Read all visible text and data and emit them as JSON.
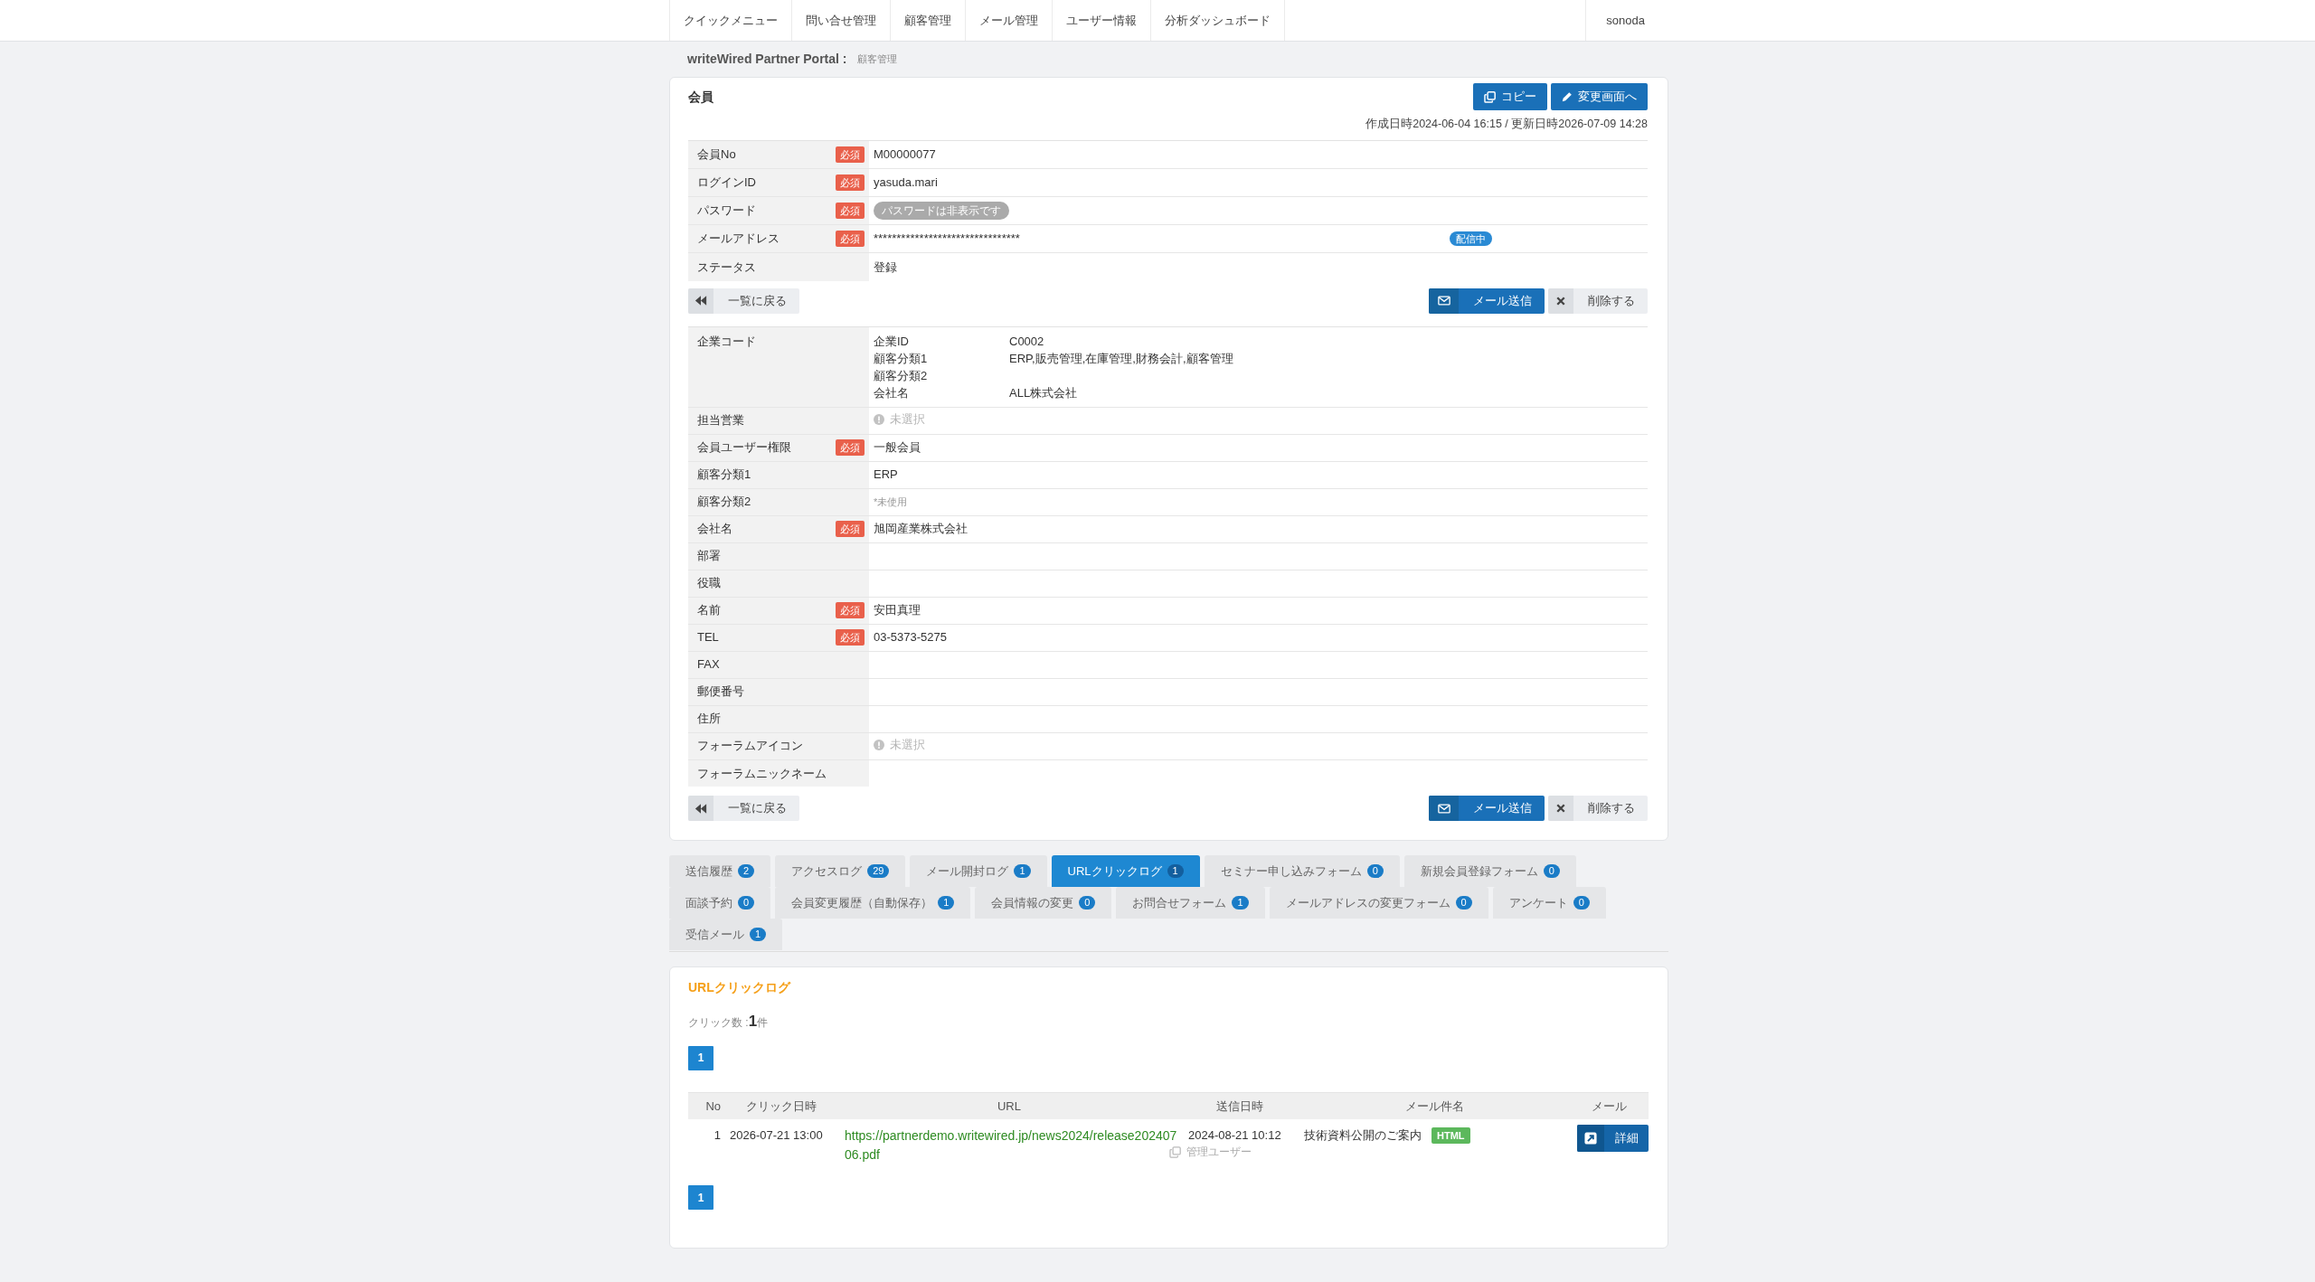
{
  "nav": {
    "items": [
      "クイックメニュー",
      "問い合せ管理",
      "顧客管理",
      "メール管理",
      "ユーザー情報",
      "分析ダッシュボード"
    ],
    "user": "sonoda"
  },
  "breadcrumb": {
    "portal": "writeWired Partner Portal :",
    "current": "顧客管理"
  },
  "member": {
    "title": "会員",
    "actions": [
      {
        "kind": "copy",
        "label": "コピー"
      },
      {
        "kind": "edit",
        "label": "変更画面へ"
      }
    ],
    "timestamps": "作成日時2024-06-04 16:15 / 更新日時2026-07-09 14:28",
    "account_fields": [
      {
        "label": "会員No",
        "badge": "必須",
        "kind": "text",
        "value": "M00000077"
      },
      {
        "label": "ログインID",
        "badge": "必須",
        "kind": "text",
        "value": "yasuda.mari"
      },
      {
        "label": "パスワード",
        "badge": "必須",
        "kind": "hidden",
        "value": "パスワードは非表示です"
      },
      {
        "label": "メールアドレス",
        "badge": "必須",
        "kind": "email",
        "value": "********************************",
        "delivery": "配信中"
      },
      {
        "label": "ステータス",
        "kind": "text",
        "value": "登録"
      }
    ],
    "account_buttons": [
      {
        "kind": "back",
        "label": "一覧に戻る"
      },
      {
        "kind": "mail",
        "label": "メール送信"
      },
      {
        "kind": "delete",
        "label": "削除する"
      }
    ],
    "profile_fields": [
      {
        "label": "企業コード",
        "kind": "company",
        "details": [
          {
            "label": "企業ID",
            "value": "C0002"
          },
          {
            "label": "顧客分類1",
            "value": "ERP,販売管理,在庫管理,財務会計,顧客管理"
          },
          {
            "label": "顧客分類2"
          },
          {
            "label": "会社名",
            "value": "ALL株式会社"
          }
        ]
      },
      {
        "label": "担当営業",
        "kind": "unselected",
        "value": "未選択"
      },
      {
        "label": "会員ユーザー権限",
        "badge": "必須",
        "kind": "text",
        "value": "一般会員"
      },
      {
        "label": "顧客分類1",
        "kind": "text",
        "value": "ERP"
      },
      {
        "label": "顧客分類2",
        "kind": "note",
        "value": "*未使用"
      },
      {
        "label": "会社名",
        "badge": "必須",
        "kind": "text",
        "value": "旭岡産業株式会社"
      },
      {
        "label": "部署",
        "kind": "text"
      },
      {
        "label": "役職",
        "kind": "text"
      },
      {
        "label": "名前",
        "badge": "必須",
        "kind": "text",
        "value": "安田真理"
      },
      {
        "label": "TEL",
        "badge": "必須",
        "kind": "text",
        "value": "03-5373-5275"
      },
      {
        "label": "FAX",
        "kind": "text"
      },
      {
        "label": "郵便番号",
        "kind": "text"
      },
      {
        "label": "住所",
        "kind": "text"
      },
      {
        "label": "フォーラムアイコン",
        "kind": "unselected",
        "value": "未選択"
      },
      {
        "label": "フォーラムニックネーム",
        "kind": "text"
      }
    ],
    "profile_buttons": [
      {
        "kind": "back",
        "label": "一覧に戻る"
      },
      {
        "kind": "mail",
        "label": "メール送信"
      },
      {
        "kind": "delete",
        "label": "削除する"
      }
    ]
  },
  "tabs": [
    {
      "label": "送信履歴",
      "count": "2",
      "selected": false
    },
    {
      "label": "アクセスログ",
      "count": "29",
      "selected": false
    },
    {
      "label": "メール開封ログ",
      "count": "1",
      "selected": false
    },
    {
      "label": "URLクリックログ",
      "count": "1",
      "selected": true
    },
    {
      "label": "セミナー申し込みフォーム",
      "count": "0",
      "selected": false
    },
    {
      "label": "新規会員登録フォーム",
      "count": "0",
      "selected": false
    },
    {
      "label": "面談予約",
      "count": "0",
      "selected": false
    },
    {
      "label": "会員変更履歴（自動保存）",
      "count": "1",
      "selected": false
    },
    {
      "label": "会員情報の変更",
      "count": "0",
      "selected": false
    },
    {
      "label": "お問合せフォーム",
      "count": "1",
      "selected": false
    },
    {
      "label": "メールアドレスの変更フォーム",
      "count": "0",
      "selected": false
    },
    {
      "label": "アンケート",
      "count": "0",
      "selected": false
    },
    {
      "label": "受信メール",
      "count": "1",
      "selected": false
    }
  ],
  "click_log": {
    "title": "URLクリックログ",
    "summary": "クリック数 :**1**件",
    "pagination_top": [
      {
        "label": "1",
        "selected": true
      }
    ],
    "table": {
      "columns": [
        "No",
        "クリック日時",
        "URL",
        "送信日時",
        "メール件名",
        "メール"
      ],
      "rows": [
        {
          "no": "1",
          "clicked_at": "2026-07-21 13:00",
          "url": "https://partnerdemo.writewired.jp/news2024/release20240706.pdf",
          "sent_at": "2024-08-21 10:12",
          "sender": "管理ユーザー",
          "subject": "技術資料公開のご案内",
          "format": "HTML",
          "action": "詳細"
        }
      ]
    },
    "pagination_bottom": [
      {
        "label": "1",
        "selected": true
      }
    ]
  }
}
